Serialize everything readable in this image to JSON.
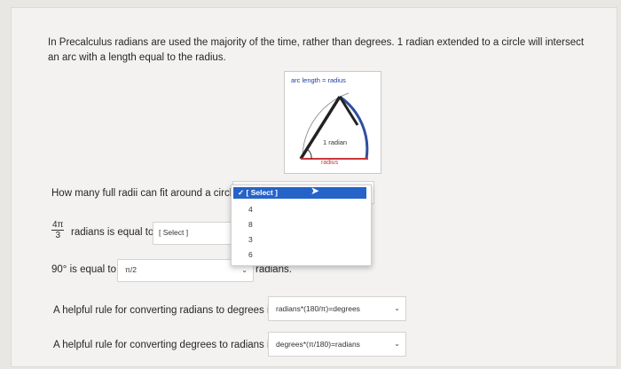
{
  "intro_text": "In Precalculus radians are used the majority of the time, rather than degrees. 1 radian extended to a circle will intersect an arc with a length equal to the radius.",
  "figure": {
    "top_label": "arc length = radius",
    "angle_label": "1 radian",
    "radius_label": "radius"
  },
  "q1": {
    "text": "How many full radii can fit around a circle",
    "dropdown": {
      "selected": "[ Select ]",
      "options": [
        "4",
        "8",
        "3",
        "6"
      ]
    }
  },
  "q2": {
    "numerator": "4π",
    "denominator": "3",
    "text": "radians is equal to",
    "select": "[ Select ]"
  },
  "q3": {
    "text": "90° is equal to",
    "select": "π/2",
    "suffix": "radians."
  },
  "q4": {
    "text": "A helpful rule for converting radians to degrees is",
    "select": "radians*(180/π)=degrees"
  },
  "q5": {
    "text": "A helpful rule for converting degrees to radians is",
    "select": "degrees*(π/180)=radians"
  },
  "colors": {
    "accent": "#2563c8",
    "arc": "#2f4fa0",
    "radius": "#c9363b"
  }
}
